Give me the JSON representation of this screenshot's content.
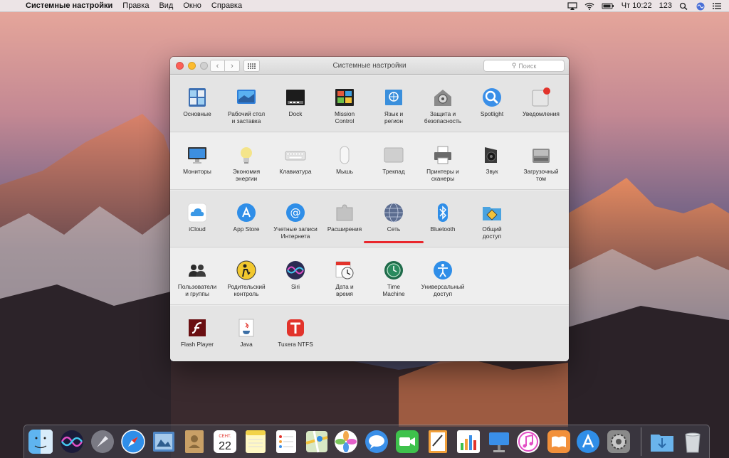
{
  "menubar": {
    "apple": "",
    "app_name": "Системные настройки",
    "items": [
      "Правка",
      "Вид",
      "Окно",
      "Справка"
    ],
    "clock": "Чт 10:22",
    "input_source": "123"
  },
  "window": {
    "title": "Системные настройки",
    "search_placeholder": "Поиск",
    "back": "‹",
    "forward": "›",
    "rows": [
      [
        "Основные",
        "Рабочий стол\nи заставка",
        "Dock",
        "Mission\nControl",
        "Язык и\nрегион",
        "Защита и\nбезопасность",
        "Spotlight",
        "Уведомления"
      ],
      [
        "Мониторы",
        "Экономия\nэнергии",
        "Клавиатура",
        "Мышь",
        "Трекпад",
        "Принтеры и\nсканеры",
        "Звук",
        "Загрузочный\nтом"
      ],
      [
        "iCloud",
        "App Store",
        "Учетные записи\nИнтернета",
        "Расширения",
        "Сеть",
        "Bluetooth",
        "Общий\nдоступ"
      ],
      [
        "Пользователи\nи группы",
        "Родительский\nконтроль",
        "Siri",
        "Дата и\nвремя",
        "Time\nMachine",
        "Универсальный\nдоступ"
      ],
      [
        "Flash Player",
        "Java",
        "Tuxera NTFS"
      ]
    ]
  },
  "dock": {
    "calendar_month": "СЕНТ.",
    "calendar_day": "22"
  }
}
